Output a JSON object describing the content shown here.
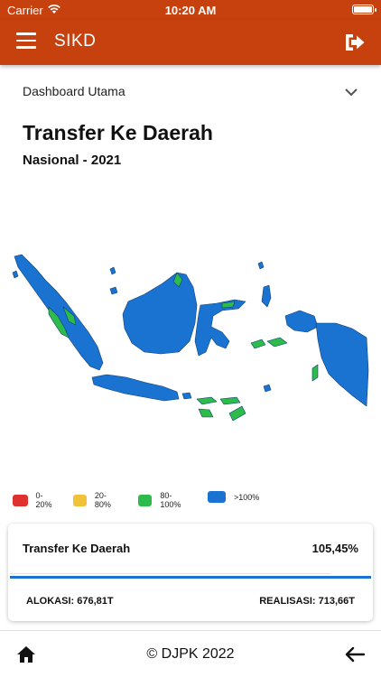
{
  "status_bar": {
    "carrier": "Carrier",
    "time": "10:20 AM",
    "wifi_icon": "wifi-icon",
    "battery_icon": "battery-icon"
  },
  "app_bar": {
    "title": "SIKD",
    "menu_icon": "menu-icon",
    "logout_icon": "logout-icon",
    "color": "#c7410f"
  },
  "dropdown": {
    "selected": "Dashboard Utama",
    "icon": "chevron-down-icon"
  },
  "page": {
    "title": "Transfer Ke Daerah",
    "subtitle": "Nasional - 2021"
  },
  "map": {
    "region_colors": {
      "blue": "#1a73d1",
      "green": "#2dbb4a"
    }
  },
  "legend": [
    {
      "label": "0-20%",
      "color": "#e03131"
    },
    {
      "label": "20-80%",
      "color": "#f2c13a"
    },
    {
      "label": "80-100%",
      "color": "#2dbb4a"
    },
    {
      "label": ">100%",
      "color": "#1a73d1"
    }
  ],
  "summary": {
    "title": "Transfer Ke Daerah",
    "percent": "105,45%",
    "progress": 1.0,
    "alokasi": "ALOKASI: 676,81T",
    "realisasi": "REALISASI: 713,66T"
  },
  "footer": {
    "copyright": "© DJPK 2022",
    "home_icon": "home-icon",
    "back_icon": "back-arrow-icon"
  }
}
